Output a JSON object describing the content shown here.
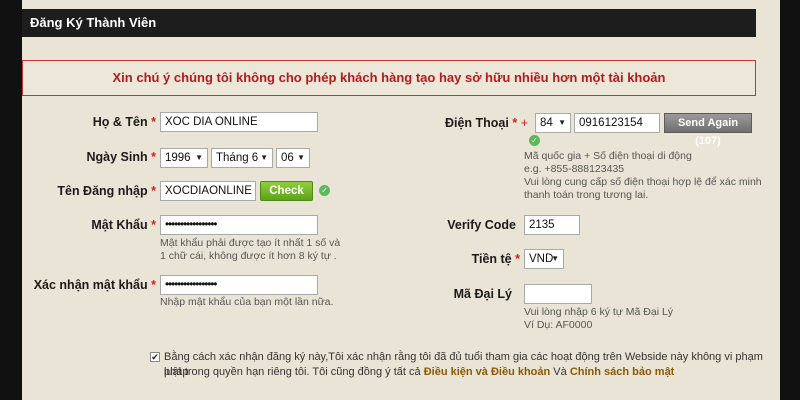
{
  "header": {
    "title": "Đăng Ký Thành Viên"
  },
  "notice": {
    "text": "Xin chú ý chúng tôi không cho phép khách hàng tạo hay sở hữu nhiều hơn một tài khoản"
  },
  "required_mark": "*",
  "left": {
    "fullname": {
      "label": "Họ & Tên",
      "value": "XOC DIA ONLINE"
    },
    "birthday": {
      "label": "Ngày Sinh",
      "year": "1996",
      "month": "Tháng 6",
      "day": "06"
    },
    "username": {
      "label": "Tên Đăng nhập",
      "value": "XOCDIAONLINE",
      "check_label": "Check"
    },
    "password": {
      "label": "Mật Khẩu",
      "value": "•••••••••••••••••",
      "hint_line1": "Mật khẩu phải được tạo ít nhất 1 số và",
      "hint_line2": "1 chữ cái, không được ít hơn 8 ký tự ."
    },
    "confirm": {
      "label": "Xác nhận mật khẩu",
      "value": "•••••••••••••••••",
      "hint": "Nhập mật khẩu của bạn một lần nữa."
    }
  },
  "right": {
    "phone": {
      "label": "Điện Thoại",
      "plus": "+",
      "country_code": "84",
      "value": "0916123154",
      "send_again_label": "Send Again (107)",
      "hint_line1": "Mã quốc gia + Số điện thoại di động",
      "hint_line2": "e.g. +855-888123435",
      "hint_line3": "Vui lòng cung cấp số điện thoại hợp lệ để xác minh",
      "hint_line4": "thanh toán trong tương lai."
    },
    "verify": {
      "label": "Verify Code",
      "value": "2135"
    },
    "currency": {
      "label": "Tiền tệ",
      "value": "VND"
    },
    "agent": {
      "label": "Mã Đại Lý",
      "value": "",
      "hint_line1": "Vui lòng nhập 6 ký tự Mã Đại Lý",
      "hint_line2": "Ví Dụ: AF0000"
    }
  },
  "agreement": {
    "checked_mark": "✔",
    "line1": "Bằng cách xác nhận đăng ký này,Tôi xác nhận rằng tôi đã đủ tuổi tham gia các hoạt động trên Webside này không vi phạm pháp",
    "line2_prefix": "luật trong quyền hạn riêng tôi. Tôi cũng đồng ý tất cả ",
    "terms_link": "Điều kiện và Điều khoản",
    "and_word": " Và ",
    "privacy_link": "Chính sách bảo mật"
  },
  "icons": {
    "ok": "check-circle-icon",
    "dropdown": "caret-down-icon"
  },
  "colors": {
    "accent_green": "#5ea21a",
    "warning_red": "#b31b1b",
    "panel_bg": "#e9e4d6",
    "header_bg": "#1d1d1d"
  }
}
